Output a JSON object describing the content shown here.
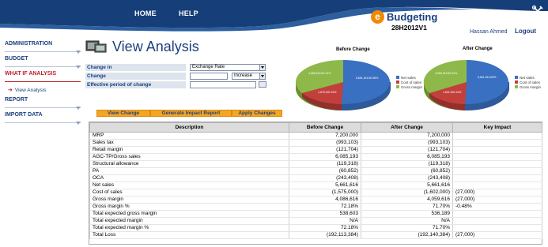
{
  "header": {
    "nav": [
      "HOME",
      "HELP"
    ],
    "logo_letter": "e",
    "logo_text": "Budgeting",
    "code": "28H2012V1",
    "user": "Hassan Ahmed",
    "logout": "Logout"
  },
  "sidebar": {
    "items": [
      "ADMINISTRATION",
      "BUDGET",
      "WHAT IF ANALYSIS",
      "REPORT",
      "IMPORT DATA"
    ],
    "sub_item": "View Analysis"
  },
  "page": {
    "title": "View Analysis"
  },
  "form": {
    "change_in_label": "Change in",
    "change_in_value": "Exchange Rate",
    "change_label": "Change",
    "change_value": "",
    "direction_value": "Increase",
    "period_label": "Effective period of change",
    "period_value": ""
  },
  "buttons": [
    "View Change",
    "Generate Impact Report",
    "Apply Changes"
  ],
  "charts": [
    {
      "title": "Before Change",
      "slices": [
        {
          "label": "Net sales",
          "color": "#3a70c1",
          "text": "5,661,616.50\n58%"
        },
        {
          "label": "Cost of sales",
          "color": "#c2403c",
          "text": "1,575,000.00\n16%"
        },
        {
          "label": "Gross margin",
          "color": "#8fb84a",
          "text": "4,086,616.50\n42%"
        }
      ]
    },
    {
      "title": "After Change",
      "slices": [
        {
          "label": "Net sales",
          "color": "#3a70c1",
          "text": "5,661,616.50\n58%"
        },
        {
          "label": "Cost of sales",
          "color": "#c2403c",
          "text": "1,602,000.00\n16%"
        },
        {
          "label": "Gross margin",
          "color": "#8fb84a",
          "text": "4,059,616.50\n42%"
        }
      ]
    }
  ],
  "table": {
    "headers": [
      "Description",
      "Before Change",
      "After Change",
      "Key Impact"
    ],
    "rows": [
      [
        "MRP",
        "7,200,000",
        "7,200,000",
        ""
      ],
      [
        "Sales tax",
        "(993,103)",
        "(993,103)",
        ""
      ],
      [
        "Retail margin",
        "(121,704)",
        "(121,704)",
        ""
      ],
      [
        "AGC-TP/Gross sales",
        "6,085,193",
        "6,085,193",
        ""
      ],
      [
        "Structural allowance",
        "(119,318)",
        "(119,318)",
        ""
      ],
      [
        "PA",
        "(60,852)",
        "(60,852)",
        ""
      ],
      [
        "OCA",
        "(243,408)",
        "(243,408)",
        ""
      ],
      [
        "Net sales",
        "5,661,616",
        "5,661,616",
        ""
      ],
      [
        "Cost of sales",
        "(1,575,000)",
        "(1,602,000)",
        "(27,000)"
      ],
      [
        "Gross margin",
        "4,086,616",
        "4,059,616",
        "(27,000)"
      ],
      [
        "Gross margin %",
        "72.18%",
        "71.70%",
        "-0.48%"
      ],
      [
        "Total expected gross margin",
        "538,603",
        "536,189",
        ""
      ],
      [
        "Total expected margin",
        "N/A",
        "N/A",
        ""
      ],
      [
        "Total expected margin %",
        "72.18%",
        "71.70%",
        ""
      ],
      [
        "Total Loss",
        "(192,113,384)",
        "(192,140,384)",
        "(27,000)"
      ]
    ]
  }
}
